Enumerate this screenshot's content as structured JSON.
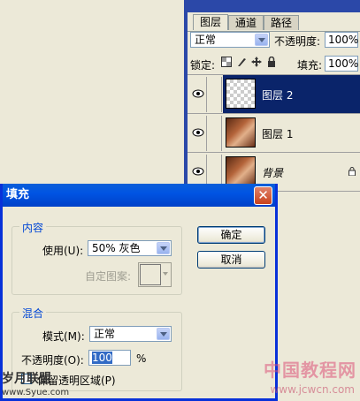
{
  "layers_panel": {
    "tabs": [
      "图层",
      "通道",
      "路径"
    ],
    "blend_mode": "正常",
    "opacity_label": "不透明度:",
    "opacity_value": "100%",
    "lock_label": "锁定:",
    "fill_label": "填充:",
    "fill_value": "100%",
    "layers": [
      {
        "name": "图层 2",
        "selected": true
      },
      {
        "name": "图层 1",
        "selected": false
      },
      {
        "name": "背景",
        "selected": false
      }
    ]
  },
  "fill_dialog": {
    "title": "填充",
    "close_glyph": "✕",
    "content_group": "内容",
    "use_label": "使用(U):",
    "use_value": "50% 灰色",
    "custom_pattern_label": "自定图案:",
    "ok_button": "确定",
    "cancel_button": "取消",
    "blend_group": "混合",
    "mode_label": "模式(M):",
    "mode_value": "正常",
    "opacity_label": "不透明度(O):",
    "opacity_value": "100",
    "percent": "%",
    "preserve_label": "保留透明区域(P)"
  },
  "watermark": {
    "left_text": "岁月联盟",
    "left_url": "www.Syue.com",
    "right_text": "中国教程网",
    "right_url": "www.jcwcn.com"
  },
  "colors": {
    "accent": "#0054e3",
    "selection": "#0a246a",
    "close": "#c9421c"
  }
}
